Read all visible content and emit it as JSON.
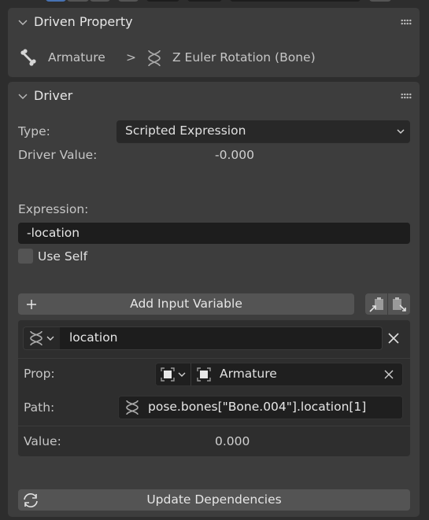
{
  "driven_property": {
    "title": "Driven Property",
    "object_name": "Armature",
    "separator": ">",
    "property_name": "Z Euler Rotation (Bone)"
  },
  "driver": {
    "title": "Driver",
    "type_label": "Type:",
    "type_value": "Scripted Expression",
    "driver_value_label": "Driver Value:",
    "driver_value": "-0.000",
    "expression_label": "Expression:",
    "expression_value": "-location",
    "use_self_label": "Use Self",
    "use_self_checked": false,
    "add_variable_label": "Add Input Variable",
    "update_dependencies_label": "Update Dependencies"
  },
  "variable": {
    "name": "location",
    "prop_label": "Prop:",
    "prop_value": "Armature",
    "path_label": "Path:",
    "path_value": "pose.bones[\"Bone.004\"].location[1]",
    "value_label": "Value:",
    "value": "0.000"
  },
  "colors": {
    "panel_bg": "#3d3d3d",
    "field_bg": "#282828",
    "text_field_bg": "#1d1d1d",
    "button_bg": "#545454",
    "accent": "#4772b3"
  }
}
